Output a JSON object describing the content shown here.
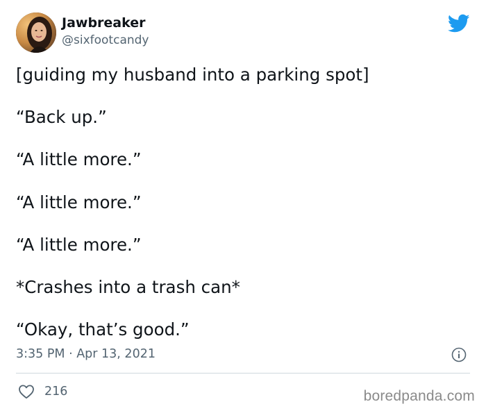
{
  "author": {
    "display_name": "Jawbreaker",
    "handle": "@sixfootcandy",
    "avatar_icon": "profile-photo"
  },
  "brand": {
    "icon": "twitter-bird-icon",
    "color": "#1d9bf0"
  },
  "tweet": {
    "lines": [
      "[guiding my husband into a parking spot]",
      "“Back up.”",
      "“A little more.”",
      "“A little more.”",
      "“A little more.”",
      "*Crashes into a trash can*",
      "“Okay, that’s good.”"
    ]
  },
  "meta": {
    "timestamp": "3:35 PM · Apr 13, 2021",
    "info_icon": "info-icon"
  },
  "actions": {
    "like_icon": "heart-icon",
    "like_count": "216"
  },
  "watermark": {
    "text": "boredpanda.com"
  },
  "colors": {
    "text_primary": "#0f1419",
    "text_secondary": "#536471",
    "divider": "#cfd9de"
  }
}
